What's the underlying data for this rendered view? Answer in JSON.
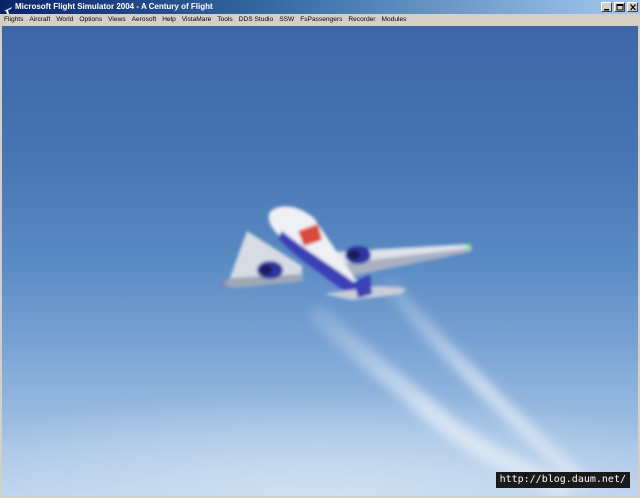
{
  "window": {
    "title": "Microsoft Flight Simulator 2004 - A Century of Flight",
    "icon": "airplane-app-icon",
    "controls": [
      "minimize-icon",
      "maximize-icon",
      "close-icon"
    ]
  },
  "menubar": {
    "items": [
      "Flights",
      "Aircraft",
      "World",
      "Options",
      "Views",
      "Aerosoft",
      "Help",
      "VistaMare",
      "Tools",
      "DDS Studio",
      "SSW",
      "FsPassengers",
      "Recorder",
      "Modules"
    ]
  },
  "scene": {
    "sky_top": "#3d66a6",
    "sky_bottom": "#b9d1ec",
    "aircraft_livery": "#3b3fb5"
  },
  "watermark": "http://blog.daum.net/"
}
